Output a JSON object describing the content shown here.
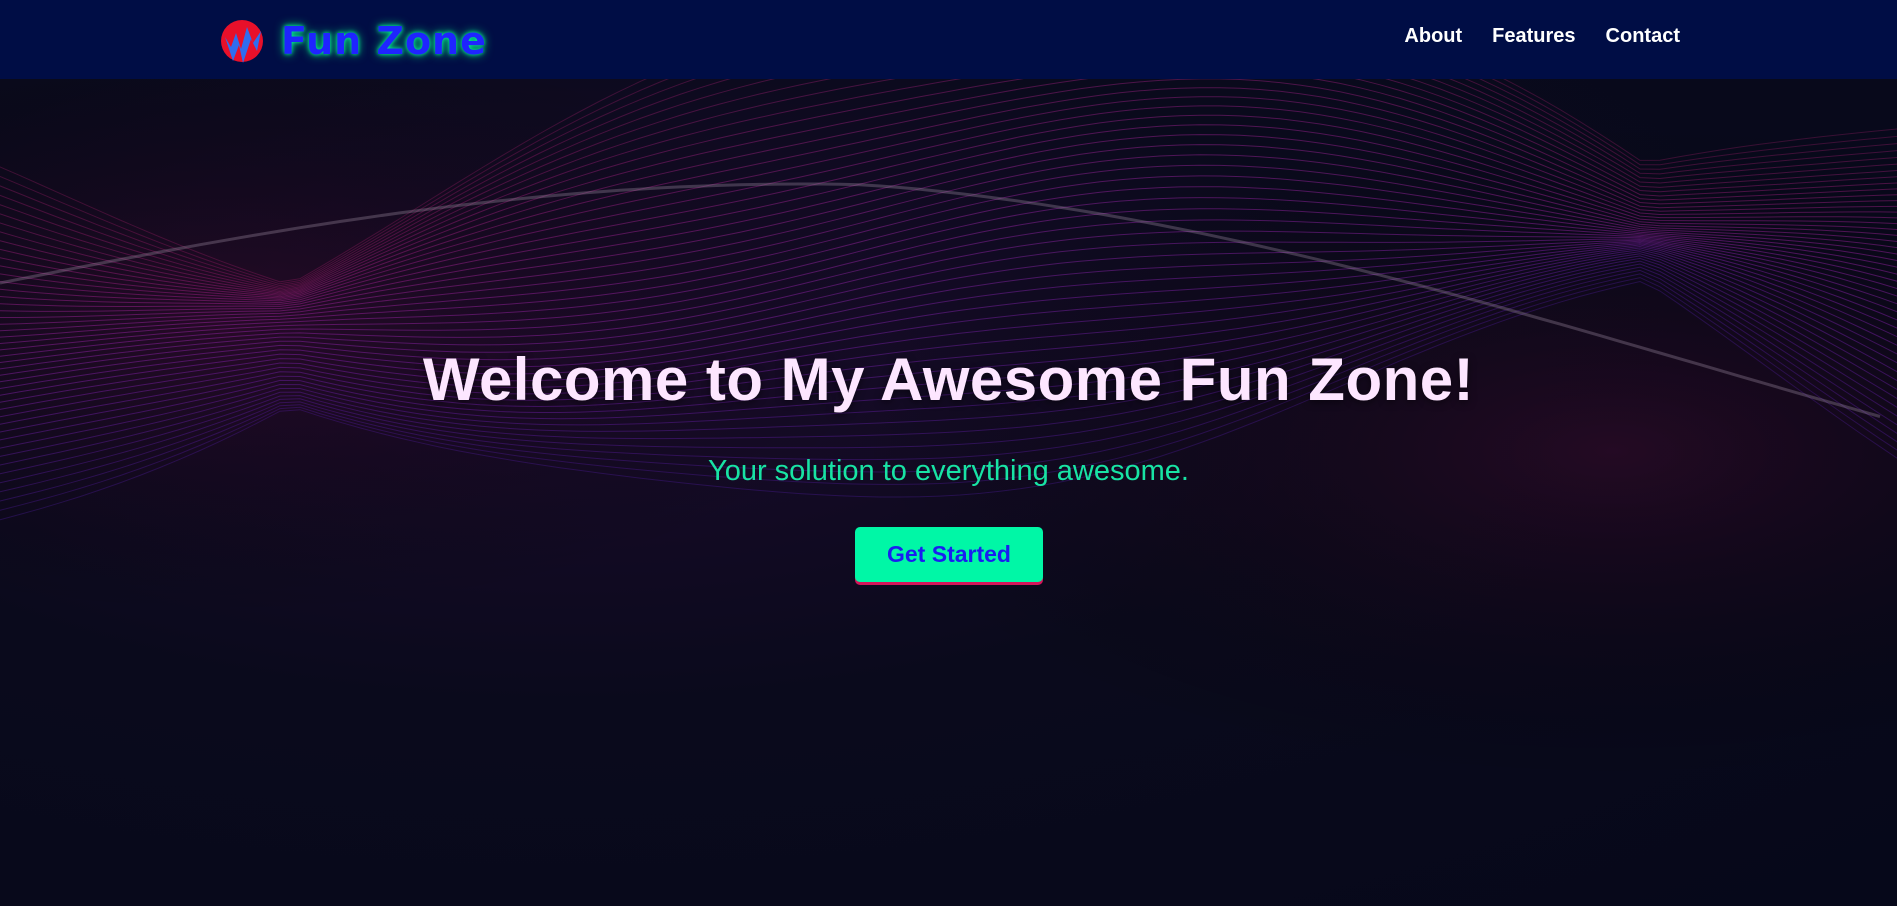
{
  "header": {
    "brand": "Fun Zone",
    "logo_icon": "lightning-w-logo-icon",
    "nav": [
      {
        "label": "About"
      },
      {
        "label": "Features"
      },
      {
        "label": "Contact"
      }
    ]
  },
  "hero": {
    "title": "Welcome to My Awesome Fun Zone!",
    "subtitle": "Your solution to everything awesome.",
    "cta_label": "Get Started"
  },
  "colors": {
    "navbar_bg": "#000d45",
    "brand_text": "#1f24ff",
    "brand_glow": "#00ff9c",
    "title": "#fde6ff",
    "subtitle": "#18e3a4",
    "cta_bg": "#00f7a6",
    "cta_text": "#1a1ef0",
    "cta_underline": "#d4145a"
  }
}
